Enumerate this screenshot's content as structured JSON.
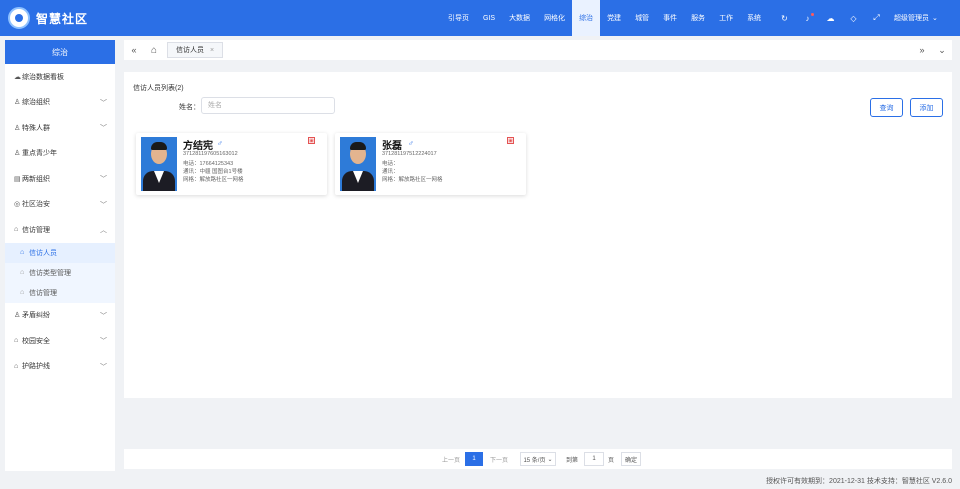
{
  "brand": {
    "name": "智慧社区"
  },
  "nav": {
    "items": [
      "引导页",
      "GIS",
      "大数据",
      "网格化",
      "综治",
      "党建",
      "城管",
      "事件",
      "服务",
      "工作",
      "系统"
    ],
    "active_index": 4
  },
  "header_icons": [
    "refresh-icon",
    "bell-icon",
    "chat-icon",
    "tag-icon",
    "fullscreen-icon"
  ],
  "user": {
    "name": "超级管理员"
  },
  "sidebar": {
    "title": "综治",
    "items": [
      {
        "label": "综治数据看板",
        "icon": "dashboard-icon",
        "expandable": false
      },
      {
        "label": "综治组织",
        "icon": "user-icon",
        "expandable": true
      },
      {
        "label": "特殊人群",
        "icon": "user-icon",
        "expandable": true
      },
      {
        "label": "重点青少年",
        "icon": "user-icon",
        "expandable": false
      },
      {
        "label": "两新组织",
        "icon": "building-icon",
        "expandable": true
      },
      {
        "label": "社区治安",
        "icon": "shield-icon",
        "expandable": true
      },
      {
        "label": "信访管理",
        "icon": "home-icon",
        "expandable": true,
        "expanded": true,
        "children": [
          "信访人员",
          "信访类型管理",
          "信访管理"
        ],
        "active_child": 0
      },
      {
        "label": "矛盾纠纷",
        "icon": "user-icon",
        "expandable": true
      },
      {
        "label": "校园安全",
        "icon": "home-icon",
        "expandable": true
      },
      {
        "label": "护路护线",
        "icon": "home-icon",
        "expandable": true
      }
    ]
  },
  "tabs": [
    {
      "label": "信访人员",
      "close": "×"
    }
  ],
  "content": {
    "list_title": "信访人员列表(2)",
    "filter_label": "姓名：",
    "filter_placeholder": "姓名",
    "search_label": "查询",
    "add_label": "添加"
  },
  "cards": [
    {
      "name": "方结宪",
      "gender": "♂",
      "id_number": "371281197605163012",
      "phone": "电话：17664125343",
      "address": "通讯：中疆 国图台1号楼",
      "grid": "网格：解放路社区一网格"
    },
    {
      "name": "张磊",
      "gender": "♂",
      "id_number": "371281197512224017",
      "phone": "电话：",
      "address": "通讯：",
      "grid": "网格：解放路社区一网格"
    }
  ],
  "pagination": {
    "prev": "上一页",
    "current": "1",
    "next": "下一页",
    "page_size": "15 条/页",
    "goto_prefix": "到第",
    "goto_value": "1",
    "goto_suffix": "页",
    "confirm": "确定"
  },
  "footer": {
    "text": "授权许可有效期到：2021-12-31 技术支持：智慧社区  V2.6.0"
  },
  "colors": {
    "primary": "#2b6fe6",
    "background": "#f0f2f5"
  }
}
